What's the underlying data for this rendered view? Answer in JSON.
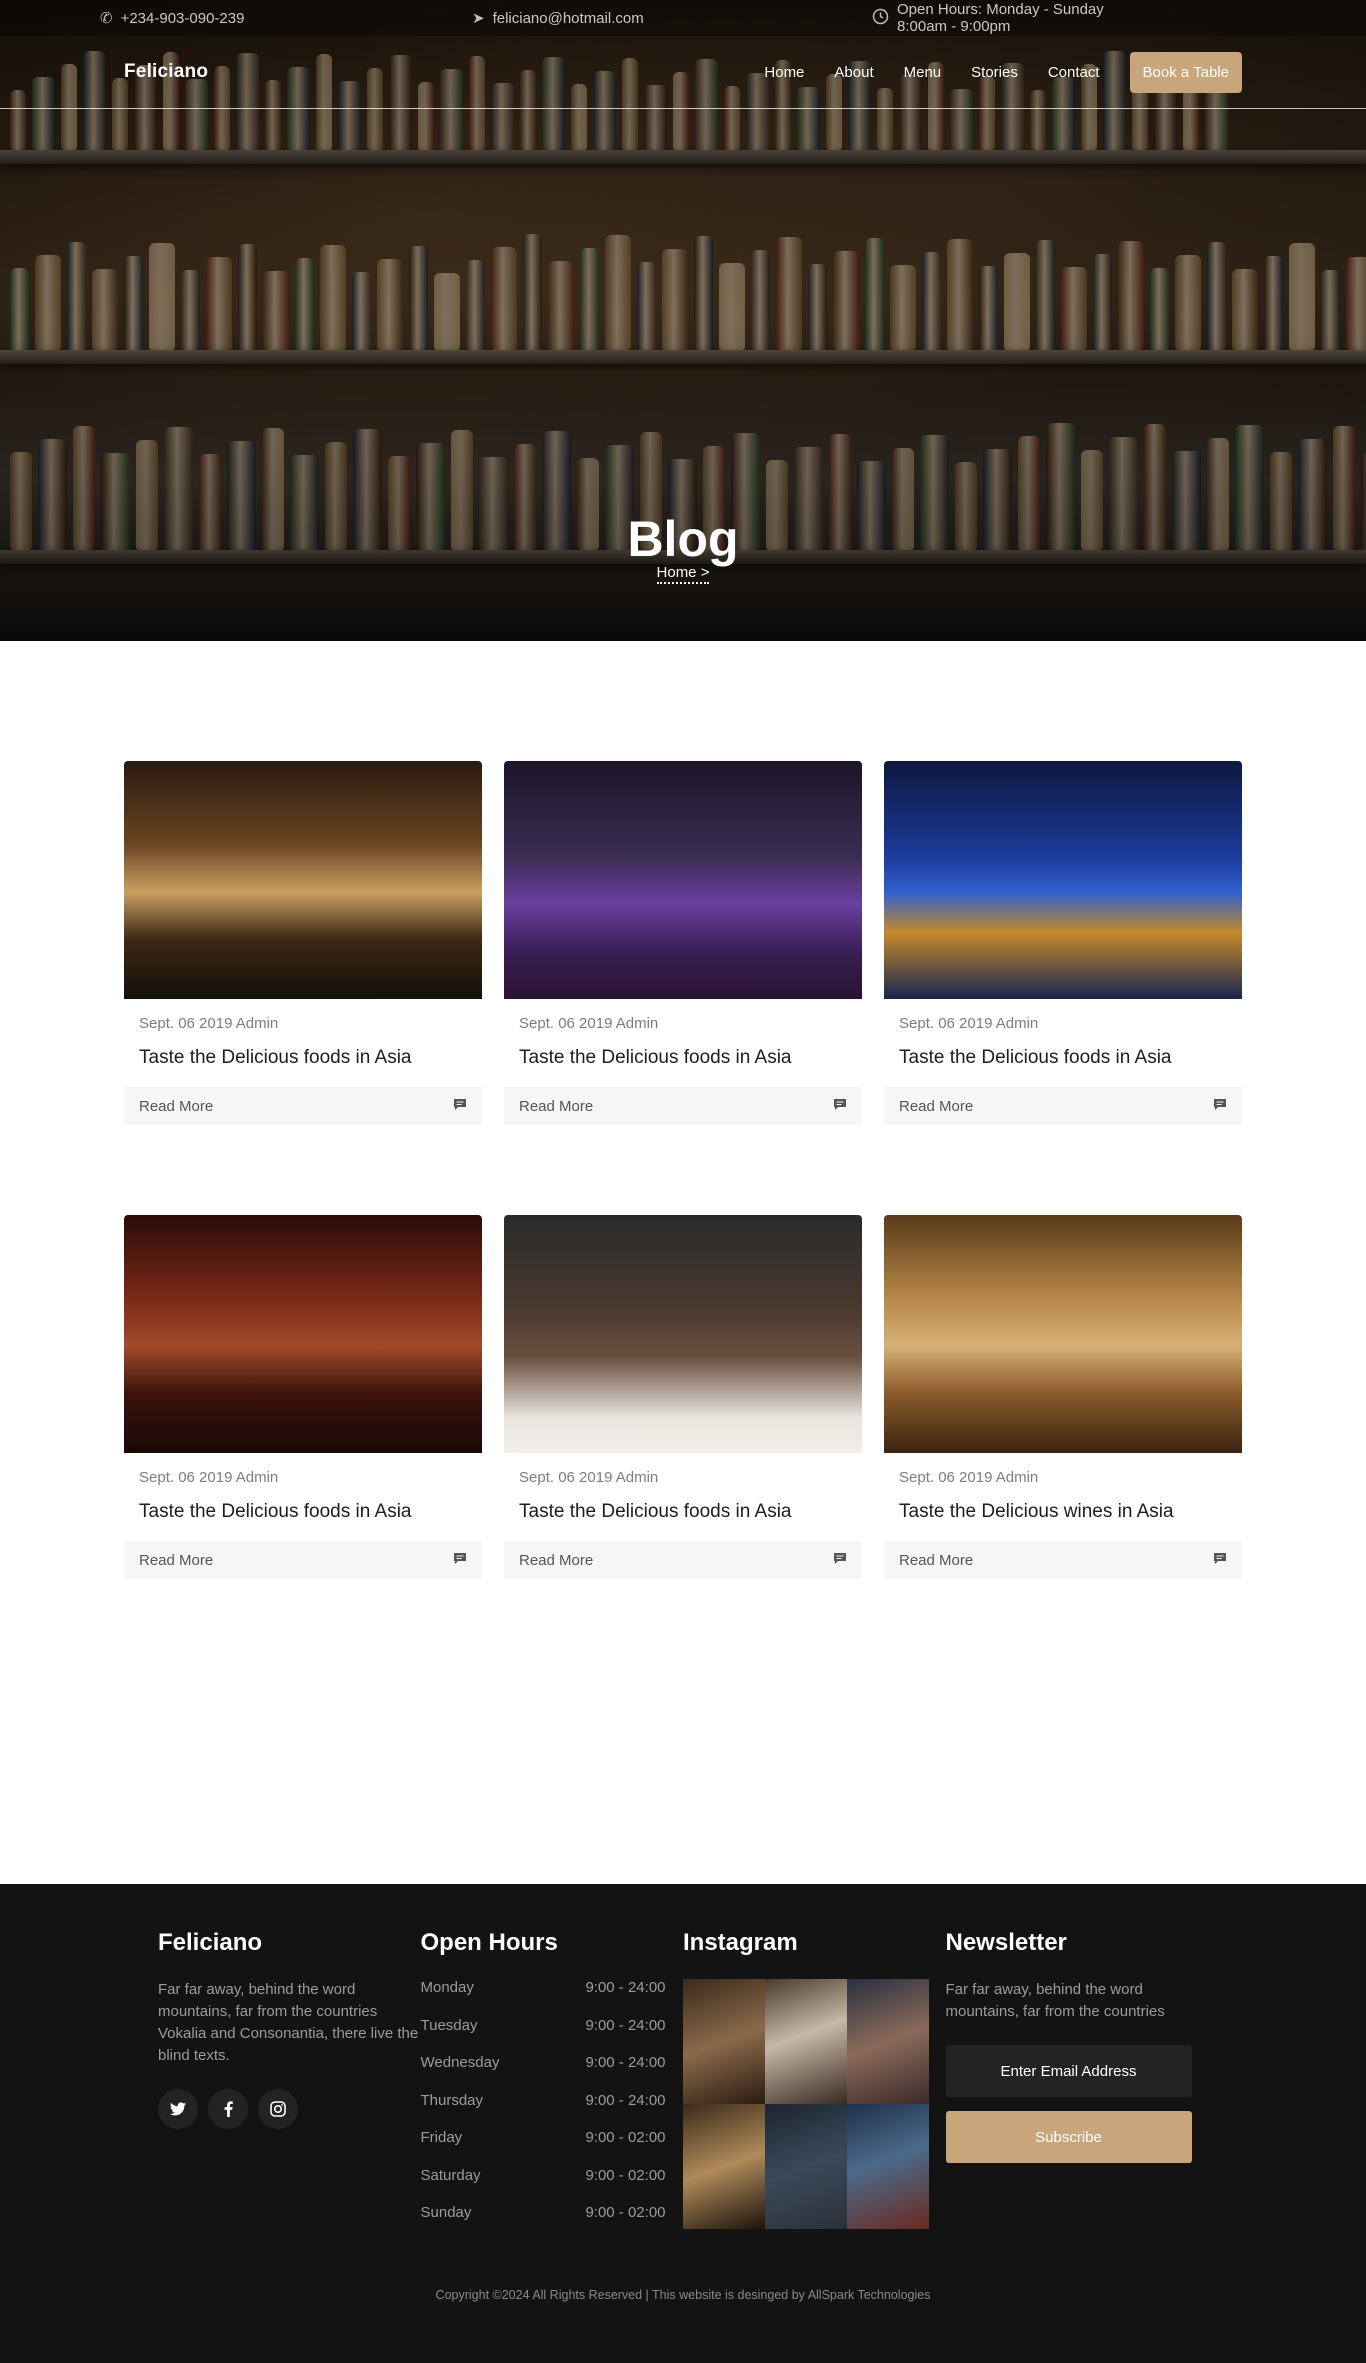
{
  "topbar": {
    "phone": "+234-903-090-239",
    "email": "feliciano@hotmail.com",
    "hours": "Open Hours: Monday - Sunday 8:00am - 9:00pm"
  },
  "nav": {
    "brand": "Feliciano",
    "items": [
      "Home",
      "About",
      "Menu",
      "Stories",
      "Contact"
    ],
    "cta": "Book a Table"
  },
  "hero": {
    "title": "Blog",
    "breadcrumb": "Home",
    "breadcrumb_sep": ">"
  },
  "posts": [
    {
      "date": "Sept. 06 2019 Admin",
      "title": "Taste the Delicious foods in Asia",
      "cta": "Read More"
    },
    {
      "date": "Sept. 06 2019 Admin",
      "title": "Taste the Delicious foods in Asia",
      "cta": "Read More"
    },
    {
      "date": "Sept. 06 2019 Admin",
      "title": "Taste the Delicious foods in Asia",
      "cta": "Read More"
    },
    {
      "date": "Sept. 06 2019 Admin",
      "title": "Taste the Delicious foods in Asia",
      "cta": "Read More"
    },
    {
      "date": "Sept. 06 2019 Admin",
      "title": "Taste the Delicious foods in Asia",
      "cta": "Read More"
    },
    {
      "date": "Sept. 06 2019 Admin",
      "title": "Taste the Delicious wines in Asia",
      "cta": "Read More"
    }
  ],
  "footer": {
    "about": {
      "title": "Feliciano",
      "text": "Far far away, behind the word mountains, far from the countries Vokalia and Consonantia, there live the blind texts."
    },
    "social_icons": [
      "twitter-icon",
      "facebook-icon",
      "instagram-icon"
    ],
    "hours": {
      "title": "Open Hours",
      "rows": [
        {
          "day": "Monday",
          "time": "9:00 - 24:00"
        },
        {
          "day": "Tuesday",
          "time": "9:00 - 24:00"
        },
        {
          "day": "Wednesday",
          "time": "9:00 - 24:00"
        },
        {
          "day": "Thursday",
          "time": "9:00 - 24:00"
        },
        {
          "day": "Friday",
          "time": "9:00 - 02:00"
        },
        {
          "day": "Saturday",
          "time": "9:00 - 02:00"
        },
        {
          "day": "Sunday",
          "time": "9:00 - 02:00"
        }
      ]
    },
    "instagram": {
      "title": "Instagram"
    },
    "newsletter": {
      "title": "Newsletter",
      "text": "Far far away, behind the word mountains, far from the countries",
      "placeholder": "Enter Email Address",
      "button": "Subscribe"
    },
    "copyright": "Copyright ©2024   All Rights Reserved | This website is desinged by AllSpark Technologies"
  },
  "colors": {
    "accent": "#c8a57a",
    "footer_bg": "#131313",
    "card_footer_bg": "#f6f6f6"
  }
}
